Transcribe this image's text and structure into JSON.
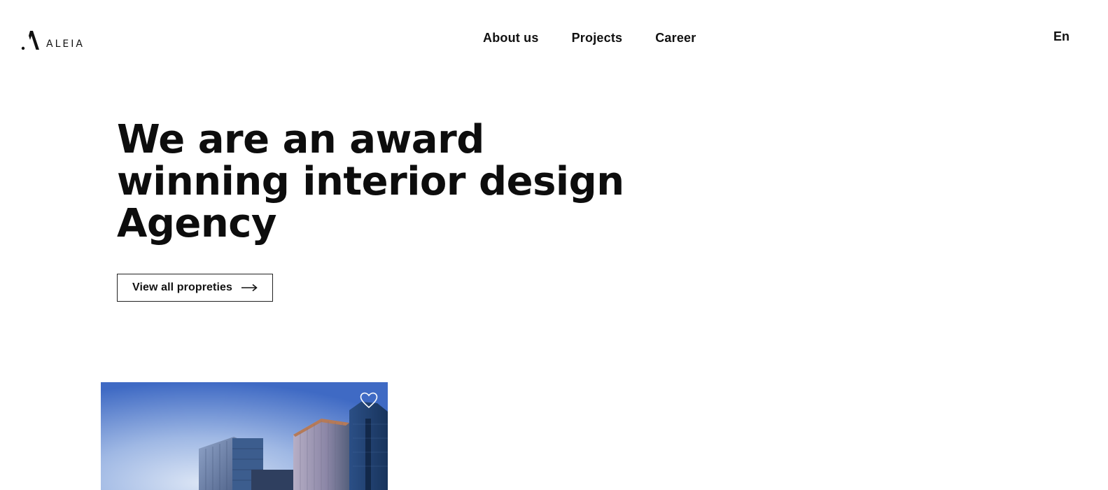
{
  "header": {
    "logo_text": "ALEIA",
    "nav": [
      {
        "label": "About us"
      },
      {
        "label": "Projects"
      },
      {
        "label": "Career"
      }
    ],
    "language": "En"
  },
  "hero": {
    "title_lines": [
      "We are an award",
      "winning interior design",
      "Agency"
    ],
    "cta_label": "View all propreties",
    "cta_icon": "arrow-right-icon"
  },
  "property_card": {
    "image": "city-skyscrapers-photo",
    "favorite_icon": "heart-outline-icon"
  },
  "colors": {
    "text": "#111111",
    "background": "#ffffff",
    "sky_top": "#3f6fc9",
    "sky_bottom": "#c9d8f0"
  }
}
